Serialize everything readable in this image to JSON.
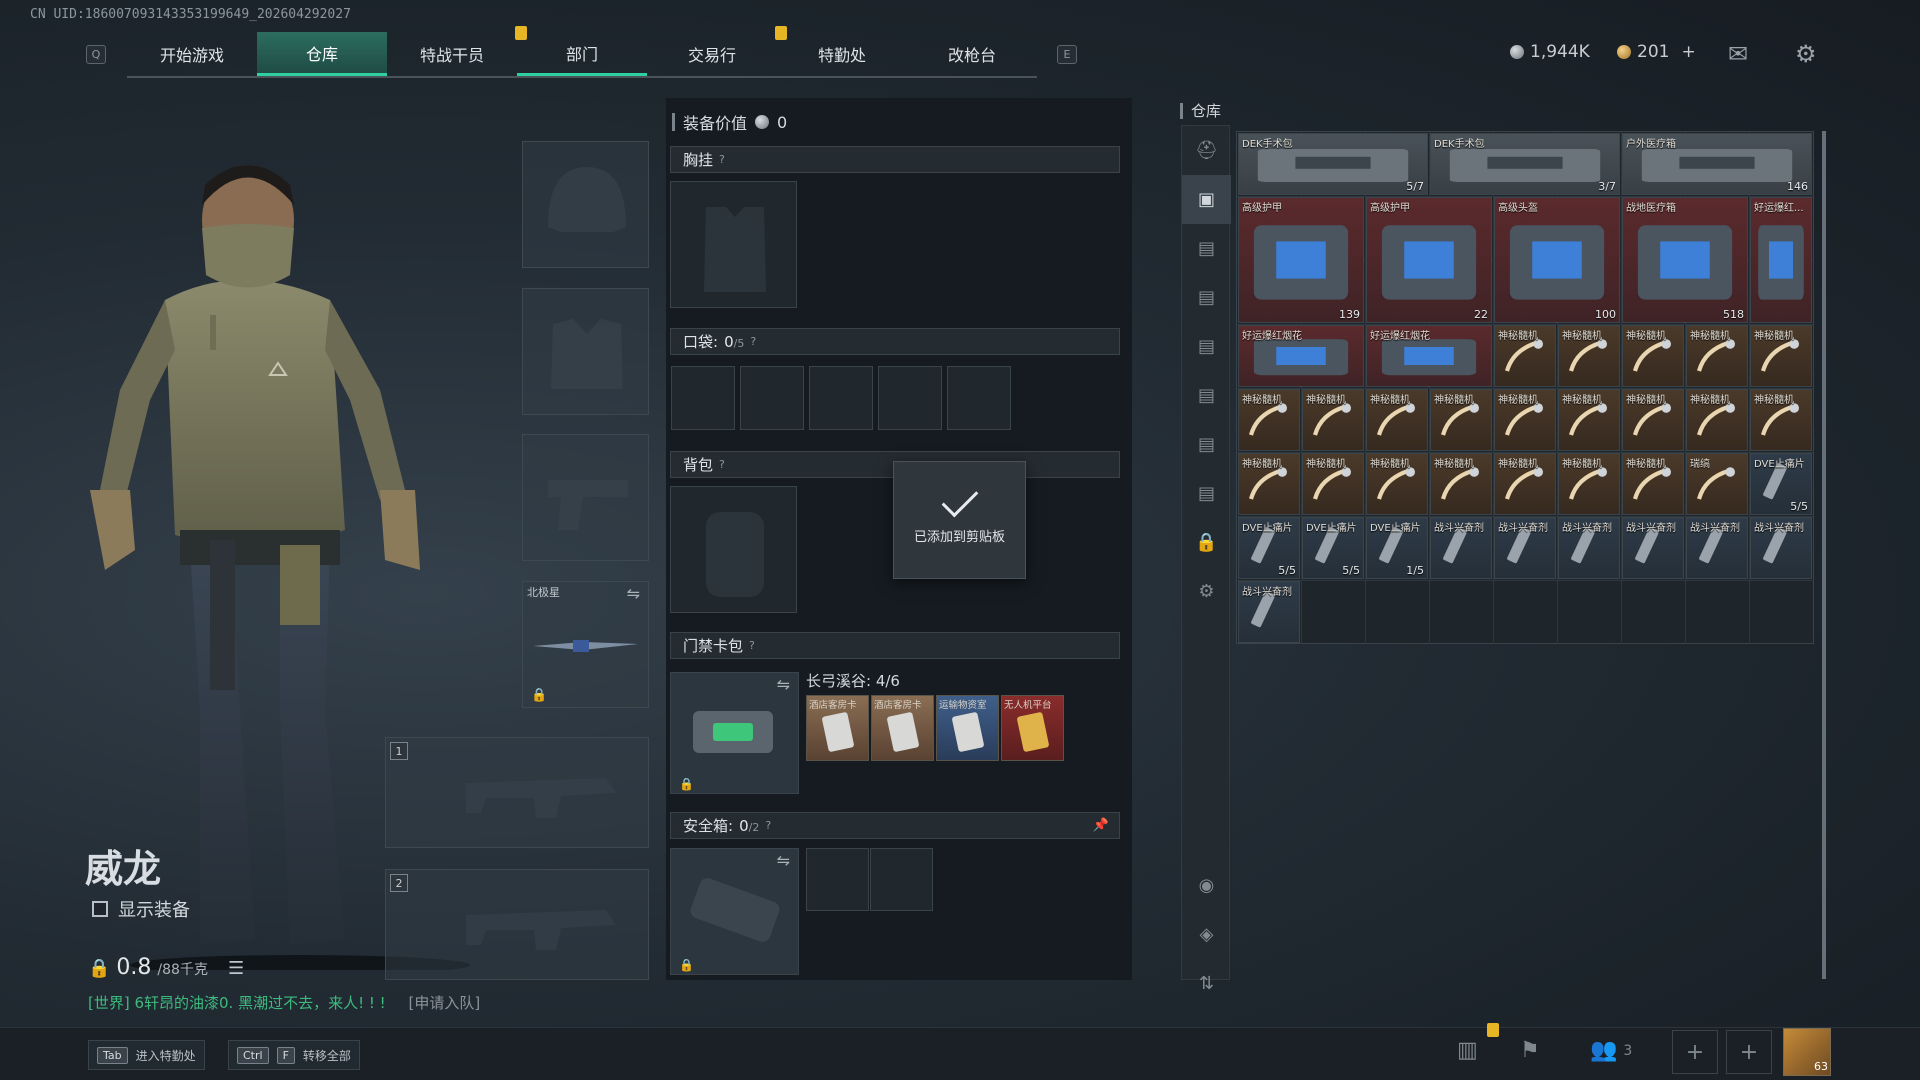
{
  "uid": "CN UID:18600709314335319964​9_202604292027",
  "topnav": {
    "left_key": "Q",
    "right_key": "E",
    "tabs": [
      "开始游戏",
      "仓库",
      "特战干员",
      "部门",
      "交易行",
      "特勤处",
      "改枪台"
    ]
  },
  "currency": {
    "silver": "1,944K",
    "gold": "201",
    "plus": "+"
  },
  "character": {
    "name": "威龙",
    "show_equipment": "显示装备",
    "weight": "0.8",
    "weight_max": "/88千克"
  },
  "chat": {
    "channel": "[世界] 6轩昂的油漆0. 黑潮过不去，来人! ! !",
    "apply": "[申请入队]"
  },
  "hints": [
    {
      "keys": [
        "Tab"
      ],
      "label": "进入特勤处"
    },
    {
      "keys": [
        "Ctrl",
        "F"
      ],
      "label": "转移全部"
    }
  ],
  "slots": {
    "melee_name": "北极星",
    "primary_1": "1",
    "primary_2": "2"
  },
  "equipment": {
    "value_label": "装备价值",
    "value": "0",
    "chest_rig": "胸挂",
    "pocket": "口袋:",
    "pocket_count": "0",
    "pocket_max": "/5",
    "backpack": "背包",
    "keycard_bag": "门禁卡包",
    "keycard_map": "长弓溪谷: 4/6",
    "keycards": [
      "酒店客房卡",
      "酒店客房卡",
      "运输物资室",
      "无人机平台"
    ],
    "safebox": "安全箱:",
    "safebox_count": "0",
    "safebox_max": "/2",
    "help": "?"
  },
  "toast": {
    "message": "已添加到剪贴板"
  },
  "inventory": {
    "title": "仓库",
    "items": [
      {
        "name": "DEK手术包",
        "count": "5/7",
        "color": "gray",
        "col": 0,
        "row": 0,
        "w": 3,
        "h": 1
      },
      {
        "name": "DEK手术包",
        "count": "3/7",
        "color": "gray",
        "col": 3,
        "row": 0,
        "w": 3,
        "h": 1
      },
      {
        "name": "户外医疗箱",
        "count": "146",
        "color": "gray",
        "col": 6,
        "row": 0,
        "w": 3,
        "h": 1
      },
      {
        "name": "高级护甲",
        "count": "139",
        "color": "red",
        "col": 0,
        "row": 1,
        "w": 2,
        "h": 2
      },
      {
        "name": "高级护甲",
        "count": "22",
        "color": "red",
        "col": 2,
        "row": 1,
        "w": 2,
        "h": 2
      },
      {
        "name": "高级头盔",
        "count": "100",
        "color": "red",
        "col": 4,
        "row": 1,
        "w": 2,
        "h": 2
      },
      {
        "name": "战地医疗箱",
        "count": "518",
        "color": "red",
        "col": 6,
        "row": 1,
        "w": 2,
        "h": 2
      },
      {
        "name": "好运爆红...",
        "count": "",
        "color": "red",
        "col": 8,
        "row": 1,
        "w": 1,
        "h": 2
      },
      {
        "name": "好运爆红烟花",
        "count": "",
        "color": "red",
        "col": 0,
        "row": 3,
        "w": 2,
        "h": 1
      },
      {
        "name": "好运爆红烟花",
        "count": "",
        "color": "red",
        "col": 2,
        "row": 3,
        "w": 2,
        "h": 1
      },
      {
        "name": "神秘髓机",
        "count": "",
        "color": "brown",
        "col": 4,
        "row": 3,
        "w": 1,
        "h": 1
      },
      {
        "name": "神秘髓机",
        "count": "",
        "color": "brown",
        "col": 5,
        "row": 3,
        "w": 1,
        "h": 1
      },
      {
        "name": "神秘髓机",
        "count": "",
        "color": "brown",
        "col": 6,
        "row": 3,
        "w": 1,
        "h": 1
      },
      {
        "name": "神秘髓机",
        "count": "",
        "color": "brown",
        "col": 7,
        "row": 3,
        "w": 1,
        "h": 1
      },
      {
        "name": "神秘髓机",
        "count": "",
        "color": "brown",
        "col": 8,
        "row": 3,
        "w": 1,
        "h": 1
      },
      {
        "name": "神秘髓机",
        "count": "",
        "color": "brown",
        "col": 0,
        "row": 4,
        "w": 1,
        "h": 1
      },
      {
        "name": "神秘髓机",
        "count": "",
        "color": "brown",
        "col": 1,
        "row": 4,
        "w": 1,
        "h": 1
      },
      {
        "name": "神秘髓机",
        "count": "",
        "color": "brown",
        "col": 2,
        "row": 4,
        "w": 1,
        "h": 1
      },
      {
        "name": "神秘髓机",
        "count": "",
        "color": "brown",
        "col": 3,
        "row": 4,
        "w": 1,
        "h": 1
      },
      {
        "name": "神秘髓机",
        "count": "",
        "color": "brown",
        "col": 4,
        "row": 4,
        "w": 1,
        "h": 1
      },
      {
        "name": "神秘髓机",
        "count": "",
        "color": "brown",
        "col": 5,
        "row": 4,
        "w": 1,
        "h": 1
      },
      {
        "name": "神秘髓机",
        "count": "",
        "color": "brown",
        "col": 6,
        "row": 4,
        "w": 1,
        "h": 1
      },
      {
        "name": "神秘髓机",
        "count": "",
        "color": "brown",
        "col": 7,
        "row": 4,
        "w": 1,
        "h": 1
      },
      {
        "name": "神秘髓机",
        "count": "",
        "color": "brown",
        "col": 8,
        "row": 4,
        "w": 1,
        "h": 1
      },
      {
        "name": "神秘髓机",
        "count": "",
        "color": "brown",
        "col": 0,
        "row": 5,
        "w": 1,
        "h": 1
      },
      {
        "name": "神秘髓机",
        "count": "",
        "color": "brown",
        "col": 1,
        "row": 5,
        "w": 1,
        "h": 1
      },
      {
        "name": "神秘髓机",
        "count": "",
        "color": "brown",
        "col": 2,
        "row": 5,
        "w": 1,
        "h": 1
      },
      {
        "name": "神秘髓机",
        "count": "",
        "color": "brown",
        "col": 3,
        "row": 5,
        "w": 1,
        "h": 1
      },
      {
        "name": "神秘髓机",
        "count": "",
        "color": "brown",
        "col": 4,
        "row": 5,
        "w": 1,
        "h": 1
      },
      {
        "name": "神秘髓机",
        "count": "",
        "color": "brown",
        "col": 5,
        "row": 5,
        "w": 1,
        "h": 1
      },
      {
        "name": "神秘髓机",
        "count": "",
        "color": "brown",
        "col": 6,
        "row": 5,
        "w": 1,
        "h": 1
      },
      {
        "name": "瑞缟",
        "count": "",
        "color": "brown",
        "col": 7,
        "row": 5,
        "w": 1,
        "h": 1
      },
      {
        "name": "DVE止痛片",
        "count": "5/5",
        "color": "blue",
        "col": 8,
        "row": 5,
        "w": 1,
        "h": 1
      },
      {
        "name": "DVE止痛片",
        "count": "5/5",
        "color": "blue",
        "col": 0,
        "row": 6,
        "w": 1,
        "h": 1
      },
      {
        "name": "DVE止痛片",
        "count": "5/5",
        "color": "blue",
        "col": 1,
        "row": 6,
        "w": 1,
        "h": 1
      },
      {
        "name": "DVE止痛片",
        "count": "1/5",
        "color": "blue",
        "col": 2,
        "row": 6,
        "w": 1,
        "h": 1
      },
      {
        "name": "战斗兴奋剂",
        "count": "",
        "color": "blue",
        "col": 3,
        "row": 6,
        "w": 1,
        "h": 1
      },
      {
        "name": "战斗兴奋剂",
        "count": "",
        "color": "blue",
        "col": 4,
        "row": 6,
        "w": 1,
        "h": 1
      },
      {
        "name": "战斗兴奋剂",
        "count": "",
        "color": "blue",
        "col": 5,
        "row": 6,
        "w": 1,
        "h": 1
      },
      {
        "name": "战斗兴奋剂",
        "count": "",
        "color": "blue",
        "col": 6,
        "row": 6,
        "w": 1,
        "h": 1
      },
      {
        "name": "战斗兴奋剂",
        "count": "",
        "color": "blue",
        "col": 7,
        "row": 6,
        "w": 1,
        "h": 1
      },
      {
        "name": "战斗兴奋剂",
        "count": "",
        "color": "blue",
        "col": 8,
        "row": 6,
        "w": 1,
        "h": 1
      },
      {
        "name": "战斗兴奋剂",
        "count": "",
        "color": "blue",
        "col": 0,
        "row": 7,
        "w": 1,
        "h": 1
      }
    ]
  },
  "bottom": {
    "team_count": "3",
    "avatar_level": "63"
  },
  "colors": {
    "accent": "#2fd0a2",
    "pin": "#e7b624",
    "chat": "#3dbb7e"
  }
}
